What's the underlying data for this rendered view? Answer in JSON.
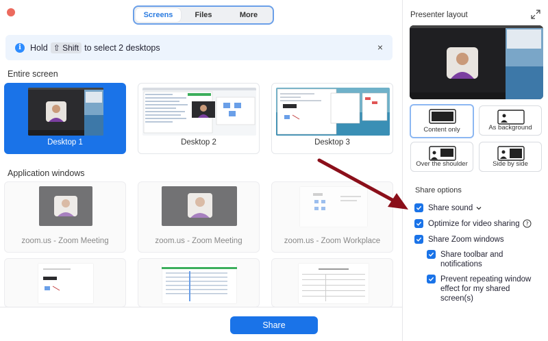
{
  "tabs": [
    {
      "label": "Screens",
      "active": true
    },
    {
      "label": "Files",
      "active": false
    },
    {
      "label": "More",
      "active": false
    }
  ],
  "banner": {
    "prefix": "Hold",
    "key": "⇧ Shift",
    "suffix": "to select 2 desktops",
    "close": "×"
  },
  "sections": {
    "entire_screen": "Entire screen",
    "application_windows": "Application windows"
  },
  "desktops": [
    {
      "label": "Desktop 1",
      "selected": true
    },
    {
      "label": "Desktop 2",
      "selected": false
    },
    {
      "label": "Desktop 3",
      "selected": false
    }
  ],
  "app_windows": [
    {
      "label": "zoom.us - Zoom Meeting"
    },
    {
      "label": "zoom.us - Zoom Meeting"
    },
    {
      "label": "zoom.us - Zoom Workplace"
    },
    {
      "label": ""
    },
    {
      "label": ""
    },
    {
      "label": ""
    }
  ],
  "share_button": "Share",
  "panel": {
    "title": "Presenter layout",
    "layouts": [
      {
        "label": "Content only",
        "active": true
      },
      {
        "label": "As background",
        "active": false
      },
      {
        "label": "Over the shoulder",
        "active": false
      },
      {
        "label": "Side by side",
        "active": false
      }
    ],
    "share_options_title": "Share options",
    "options": [
      {
        "label": "Share sound",
        "checked": true
      },
      {
        "label": "Optimize for video sharing",
        "checked": true
      },
      {
        "label": "Share Zoom windows",
        "checked": true
      },
      {
        "label": "Share toolbar and notifications",
        "checked": true
      },
      {
        "label": "Prevent repeating window effect for my shared screen(s)",
        "checked": true
      }
    ]
  },
  "colors": {
    "accent": "#1a73e8",
    "annotation_arrow": "#8b0f1a"
  }
}
